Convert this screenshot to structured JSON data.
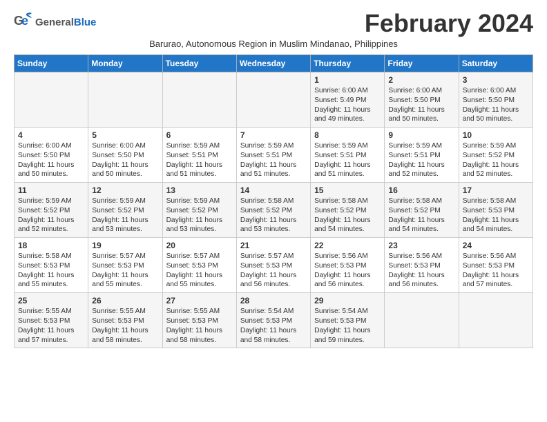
{
  "header": {
    "logo_general": "General",
    "logo_blue": "Blue",
    "month_year": "February 2024",
    "subtitle": "Barurao, Autonomous Region in Muslim Mindanao, Philippines"
  },
  "days_of_week": [
    "Sunday",
    "Monday",
    "Tuesday",
    "Wednesday",
    "Thursday",
    "Friday",
    "Saturday"
  ],
  "weeks": [
    {
      "cells": [
        {
          "day": "",
          "content": ""
        },
        {
          "day": "",
          "content": ""
        },
        {
          "day": "",
          "content": ""
        },
        {
          "day": "",
          "content": ""
        },
        {
          "day": "1",
          "content": "Sunrise: 6:00 AM\nSunset: 5:49 PM\nDaylight: 11 hours and 49 minutes."
        },
        {
          "day": "2",
          "content": "Sunrise: 6:00 AM\nSunset: 5:50 PM\nDaylight: 11 hours and 50 minutes."
        },
        {
          "day": "3",
          "content": "Sunrise: 6:00 AM\nSunset: 5:50 PM\nDaylight: 11 hours and 50 minutes."
        }
      ]
    },
    {
      "cells": [
        {
          "day": "4",
          "content": "Sunrise: 6:00 AM\nSunset: 5:50 PM\nDaylight: 11 hours and 50 minutes."
        },
        {
          "day": "5",
          "content": "Sunrise: 6:00 AM\nSunset: 5:50 PM\nDaylight: 11 hours and 50 minutes."
        },
        {
          "day": "6",
          "content": "Sunrise: 5:59 AM\nSunset: 5:51 PM\nDaylight: 11 hours and 51 minutes."
        },
        {
          "day": "7",
          "content": "Sunrise: 5:59 AM\nSunset: 5:51 PM\nDaylight: 11 hours and 51 minutes."
        },
        {
          "day": "8",
          "content": "Sunrise: 5:59 AM\nSunset: 5:51 PM\nDaylight: 11 hours and 51 minutes."
        },
        {
          "day": "9",
          "content": "Sunrise: 5:59 AM\nSunset: 5:51 PM\nDaylight: 11 hours and 52 minutes."
        },
        {
          "day": "10",
          "content": "Sunrise: 5:59 AM\nSunset: 5:52 PM\nDaylight: 11 hours and 52 minutes."
        }
      ]
    },
    {
      "cells": [
        {
          "day": "11",
          "content": "Sunrise: 5:59 AM\nSunset: 5:52 PM\nDaylight: 11 hours and 52 minutes."
        },
        {
          "day": "12",
          "content": "Sunrise: 5:59 AM\nSunset: 5:52 PM\nDaylight: 11 hours and 53 minutes."
        },
        {
          "day": "13",
          "content": "Sunrise: 5:59 AM\nSunset: 5:52 PM\nDaylight: 11 hours and 53 minutes."
        },
        {
          "day": "14",
          "content": "Sunrise: 5:58 AM\nSunset: 5:52 PM\nDaylight: 11 hours and 53 minutes."
        },
        {
          "day": "15",
          "content": "Sunrise: 5:58 AM\nSunset: 5:52 PM\nDaylight: 11 hours and 54 minutes."
        },
        {
          "day": "16",
          "content": "Sunrise: 5:58 AM\nSunset: 5:52 PM\nDaylight: 11 hours and 54 minutes."
        },
        {
          "day": "17",
          "content": "Sunrise: 5:58 AM\nSunset: 5:53 PM\nDaylight: 11 hours and 54 minutes."
        }
      ]
    },
    {
      "cells": [
        {
          "day": "18",
          "content": "Sunrise: 5:58 AM\nSunset: 5:53 PM\nDaylight: 11 hours and 55 minutes."
        },
        {
          "day": "19",
          "content": "Sunrise: 5:57 AM\nSunset: 5:53 PM\nDaylight: 11 hours and 55 minutes."
        },
        {
          "day": "20",
          "content": "Sunrise: 5:57 AM\nSunset: 5:53 PM\nDaylight: 11 hours and 55 minutes."
        },
        {
          "day": "21",
          "content": "Sunrise: 5:57 AM\nSunset: 5:53 PM\nDaylight: 11 hours and 56 minutes."
        },
        {
          "day": "22",
          "content": "Sunrise: 5:56 AM\nSunset: 5:53 PM\nDaylight: 11 hours and 56 minutes."
        },
        {
          "day": "23",
          "content": "Sunrise: 5:56 AM\nSunset: 5:53 PM\nDaylight: 11 hours and 56 minutes."
        },
        {
          "day": "24",
          "content": "Sunrise: 5:56 AM\nSunset: 5:53 PM\nDaylight: 11 hours and 57 minutes."
        }
      ]
    },
    {
      "cells": [
        {
          "day": "25",
          "content": "Sunrise: 5:55 AM\nSunset: 5:53 PM\nDaylight: 11 hours and 57 minutes."
        },
        {
          "day": "26",
          "content": "Sunrise: 5:55 AM\nSunset: 5:53 PM\nDaylight: 11 hours and 58 minutes."
        },
        {
          "day": "27",
          "content": "Sunrise: 5:55 AM\nSunset: 5:53 PM\nDaylight: 11 hours and 58 minutes."
        },
        {
          "day": "28",
          "content": "Sunrise: 5:54 AM\nSunset: 5:53 PM\nDaylight: 11 hours and 58 minutes."
        },
        {
          "day": "29",
          "content": "Sunrise: 5:54 AM\nSunset: 5:53 PM\nDaylight: 11 hours and 59 minutes."
        },
        {
          "day": "",
          "content": ""
        },
        {
          "day": "",
          "content": ""
        }
      ]
    }
  ]
}
